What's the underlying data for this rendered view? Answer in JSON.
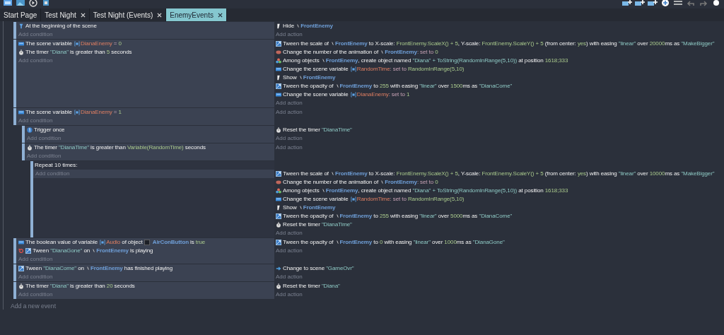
{
  "tabs": [
    {
      "label": "Start Page",
      "closable": false,
      "selected": false
    },
    {
      "label": "Test Night",
      "closable": true,
      "selected": false
    },
    {
      "label": "Test Night (Events)",
      "closable": true,
      "selected": false
    },
    {
      "label": "EnemyEvents",
      "closable": true,
      "selected": true
    }
  ],
  "events": [
    {
      "kind": "standard",
      "add_condition": "Add condition",
      "add_action": "Add action",
      "conditions": [
        {
          "kind": "scene-start",
          "inverted": false,
          "parts": [
            {
              "text": "At the beginning of the scene",
              "kind": "text"
            }
          ]
        }
      ],
      "actions": [
        {
          "kind": "visibility",
          "parts": [
            {
              "text": "Hide ",
              "kind": "text"
            },
            {
              "text": "FrontEnemy",
              "kind": "object"
            }
          ]
        }
      ]
    },
    {
      "kind": "standard",
      "add_condition": "Add condition",
      "add_action": "Add action",
      "conditions": [
        {
          "kind": "variable",
          "inverted": false,
          "parts": [
            {
              "text": "The scene variable ",
              "kind": "text"
            },
            {
              "text": "DianaEnemy",
              "kind": "variable"
            },
            {
              "text": " = ",
              "kind": "op"
            },
            {
              "text": "0",
              "kind": "number"
            }
          ]
        },
        {
          "kind": "timer",
          "inverted": false,
          "parts": [
            {
              "text": "The timer ",
              "kind": "text"
            },
            {
              "text": "\"Diana\"",
              "kind": "string"
            },
            {
              "text": " is greater than ",
              "kind": "text"
            },
            {
              "text": "5",
              "kind": "number"
            },
            {
              "text": " seconds",
              "kind": "text"
            }
          ]
        }
      ],
      "actions": [
        {
          "kind": "tween",
          "parts": [
            {
              "text": "Tween the scale of ",
              "kind": "text"
            },
            {
              "text": "FrontEnemy",
              "kind": "object"
            },
            {
              "text": " to X-scale: ",
              "kind": "text"
            },
            {
              "text": "FrontEnemy.ScaleX() + 5",
              "kind": "expr"
            },
            {
              "text": ", Y-scale: ",
              "kind": "text"
            },
            {
              "text": "FrontEnemy.ScaleY() + 5",
              "kind": "expr"
            },
            {
              "text": " (from center: ",
              "kind": "text"
            },
            {
              "text": "yes",
              "kind": "expr"
            },
            {
              "text": ") with easing ",
              "kind": "text"
            },
            {
              "text": "\"linear\"",
              "kind": "string"
            },
            {
              "text": " over ",
              "kind": "text"
            },
            {
              "text": "20000",
              "kind": "number"
            },
            {
              "text": "ms as ",
              "kind": "text"
            },
            {
              "text": "\"MakeBigger\"",
              "kind": "string"
            }
          ]
        },
        {
          "kind": "animation",
          "parts": [
            {
              "text": "Change the number of the animation of ",
              "kind": "text"
            },
            {
              "text": "FrontEnemy",
              "kind": "object"
            },
            {
              "text": ": set to ",
              "kind": "op"
            },
            {
              "text": "0",
              "kind": "number"
            }
          ]
        },
        {
          "kind": "create",
          "parts": [
            {
              "text": "Among objects ",
              "kind": "text"
            },
            {
              "text": "FrontEnemy",
              "kind": "object"
            },
            {
              "text": ", create object named ",
              "kind": "text"
            },
            {
              "text": "\"Diana\" + ToString(RandomInRange(5,10))",
              "kind": "string"
            },
            {
              "text": " at position ",
              "kind": "text"
            },
            {
              "text": "1618;333",
              "kind": "number"
            }
          ]
        },
        {
          "kind": "variable",
          "parts": [
            {
              "text": "Change the scene variable ",
              "kind": "text"
            },
            {
              "text": "RandomTime",
              "kind": "variable"
            },
            {
              "text": ": set to ",
              "kind": "op"
            },
            {
              "text": "RandomInRange(5,10)",
              "kind": "expr"
            }
          ]
        },
        {
          "kind": "visibility",
          "parts": [
            {
              "text": "Show ",
              "kind": "text"
            },
            {
              "text": "FrontEnemy",
              "kind": "object"
            }
          ]
        },
        {
          "kind": "tween",
          "parts": [
            {
              "text": "Tween the opacity of ",
              "kind": "text"
            },
            {
              "text": "FrontEnemy",
              "kind": "object"
            },
            {
              "text": " to ",
              "kind": "text"
            },
            {
              "text": "255",
              "kind": "number"
            },
            {
              "text": " with easing ",
              "kind": "text"
            },
            {
              "text": "\"linear\"",
              "kind": "string"
            },
            {
              "text": " over ",
              "kind": "text"
            },
            {
              "text": "1500",
              "kind": "number"
            },
            {
              "text": "ms as ",
              "kind": "text"
            },
            {
              "text": "\"DianaCome\"",
              "kind": "string"
            }
          ]
        },
        {
          "kind": "variable",
          "parts": [
            {
              "text": "Change the scene variable ",
              "kind": "text"
            },
            {
              "text": "DianaEnemy",
              "kind": "variable"
            },
            {
              "text": ": set to ",
              "kind": "op"
            },
            {
              "text": "1",
              "kind": "number"
            }
          ]
        }
      ]
    },
    {
      "kind": "standard",
      "add_condition": "Add condition",
      "add_action": "Add action",
      "conditions": [
        {
          "kind": "variable",
          "inverted": false,
          "parts": [
            {
              "text": "The scene variable ",
              "kind": "text"
            },
            {
              "text": "DianaEnemy",
              "kind": "variable"
            },
            {
              "text": " = ",
              "kind": "op"
            },
            {
              "text": "1",
              "kind": "number"
            }
          ]
        }
      ],
      "children": [
        {
          "kind": "standard",
          "add_condition": "Add condition",
          "add_action": "Add action",
          "conditions": [
            {
              "kind": "trigger",
              "inverted": false,
              "parts": [
                {
                  "text": "Trigger once",
                  "kind": "text"
                }
              ]
            }
          ],
          "actions": [
            {
              "kind": "timer",
              "parts": [
                {
                  "text": "Reset the timer ",
                  "kind": "text"
                },
                {
                  "text": "\"DianaTime\"",
                  "kind": "string"
                }
              ]
            }
          ]
        },
        {
          "kind": "standard",
          "add_condition": "Add condition",
          "add_action": "Add action",
          "conditions": [
            {
              "kind": "timer",
              "inverted": false,
              "parts": [
                {
                  "text": "The timer ",
                  "kind": "text"
                },
                {
                  "text": "\"DianaTime\"",
                  "kind": "string"
                },
                {
                  "text": " is greater than ",
                  "kind": "text"
                },
                {
                  "text": "Variable(RandomTime)",
                  "kind": "expr"
                },
                {
                  "text": " seconds",
                  "kind": "text"
                }
              ]
            }
          ],
          "children": [
            {
              "kind": "repeat",
              "header": "Repeat 10 times:",
              "add_condition": "Add condition",
              "add_action": "Add action",
              "actions": [
                {
                  "kind": "tween",
                  "parts": [
                    {
                      "text": "Tween the scale of ",
                      "kind": "text"
                    },
                    {
                      "text": "FrontEnemy",
                      "kind": "object"
                    },
                    {
                      "text": " to X-scale: ",
                      "kind": "text"
                    },
                    {
                      "text": "FrontEnemy.ScaleX() + 5",
                      "kind": "expr"
                    },
                    {
                      "text": ", Y-scale: ",
                      "kind": "text"
                    },
                    {
                      "text": "FrontEnemy.ScaleY() + 5",
                      "kind": "expr"
                    },
                    {
                      "text": " (from center: ",
                      "kind": "text"
                    },
                    {
                      "text": "yes",
                      "kind": "expr"
                    },
                    {
                      "text": ") with easing ",
                      "kind": "text"
                    },
                    {
                      "text": "\"linear\"",
                      "kind": "string"
                    },
                    {
                      "text": " over ",
                      "kind": "text"
                    },
                    {
                      "text": "10000",
                      "kind": "number"
                    },
                    {
                      "text": "ms as ",
                      "kind": "text"
                    },
                    {
                      "text": "\"MakeBigger\"",
                      "kind": "string"
                    }
                  ]
                },
                {
                  "kind": "animation",
                  "parts": [
                    {
                      "text": "Change the number of the animation of ",
                      "kind": "text"
                    },
                    {
                      "text": "FrontEnemy",
                      "kind": "object"
                    },
                    {
                      "text": ": set to ",
                      "kind": "op"
                    },
                    {
                      "text": "0",
                      "kind": "number"
                    }
                  ]
                },
                {
                  "kind": "create",
                  "parts": [
                    {
                      "text": "Among objects ",
                      "kind": "text"
                    },
                    {
                      "text": "FrontEnemy",
                      "kind": "object"
                    },
                    {
                      "text": ", create object named ",
                      "kind": "text"
                    },
                    {
                      "text": "\"Diana\" + ToString(RandomInRange(5,10))",
                      "kind": "string"
                    },
                    {
                      "text": " at position ",
                      "kind": "text"
                    },
                    {
                      "text": "1618;333",
                      "kind": "number"
                    }
                  ]
                },
                {
                  "kind": "variable",
                  "parts": [
                    {
                      "text": "Change the scene variable ",
                      "kind": "text"
                    },
                    {
                      "text": "RandomTime",
                      "kind": "variable"
                    },
                    {
                      "text": ": set to ",
                      "kind": "op"
                    },
                    {
                      "text": "RandomInRange(5,10)",
                      "kind": "expr"
                    }
                  ]
                },
                {
                  "kind": "visibility",
                  "parts": [
                    {
                      "text": "Show ",
                      "kind": "text"
                    },
                    {
                      "text": "FrontEnemy",
                      "kind": "object"
                    }
                  ]
                },
                {
                  "kind": "tween",
                  "parts": [
                    {
                      "text": "Tween the opacity of ",
                      "kind": "text"
                    },
                    {
                      "text": "FrontEnemy",
                      "kind": "object"
                    },
                    {
                      "text": " to ",
                      "kind": "text"
                    },
                    {
                      "text": "255",
                      "kind": "number"
                    },
                    {
                      "text": " with easing ",
                      "kind": "text"
                    },
                    {
                      "text": "\"linear\"",
                      "kind": "string"
                    },
                    {
                      "text": " over ",
                      "kind": "text"
                    },
                    {
                      "text": "5000",
                      "kind": "number"
                    },
                    {
                      "text": "ms as ",
                      "kind": "text"
                    },
                    {
                      "text": "\"DianaCome\"",
                      "kind": "string"
                    }
                  ]
                },
                {
                  "kind": "timer",
                  "parts": [
                    {
                      "text": "Reset the timer ",
                      "kind": "text"
                    },
                    {
                      "text": "\"DianaTime\"",
                      "kind": "string"
                    }
                  ]
                }
              ]
            }
          ]
        }
      ]
    },
    {
      "kind": "standard",
      "add_condition": "Add condition",
      "add_action": "Add action",
      "conditions": [
        {
          "kind": "boolean",
          "inverted": false,
          "parts": [
            {
              "text": "The boolean value of variable ",
              "kind": "text"
            },
            {
              "text": "Audio",
              "kind": "variable"
            },
            {
              "text": " of object ",
              "kind": "text"
            },
            {
              "text": "AirConButton",
              "kind": "button-object"
            },
            {
              "text": " is ",
              "kind": "text"
            },
            {
              "text": "true",
              "kind": "expr"
            }
          ]
        },
        {
          "kind": "tween",
          "inverted": true,
          "parts": [
            {
              "text": "Tween ",
              "kind": "text"
            },
            {
              "text": "\"DianaGone\"",
              "kind": "string"
            },
            {
              "text": " on ",
              "kind": "text"
            },
            {
              "text": "FrontEnemy",
              "kind": "object"
            },
            {
              "text": " is playing",
              "kind": "text"
            }
          ]
        }
      ],
      "actions": [
        {
          "kind": "tween",
          "parts": [
            {
              "text": "Tween the opacity of ",
              "kind": "text"
            },
            {
              "text": "FrontEnemy",
              "kind": "object"
            },
            {
              "text": " to ",
              "kind": "text"
            },
            {
              "text": "0",
              "kind": "number"
            },
            {
              "text": " with easing ",
              "kind": "text"
            },
            {
              "text": "\"linear\"",
              "kind": "string"
            },
            {
              "text": " over ",
              "kind": "text"
            },
            {
              "text": "1000",
              "kind": "number"
            },
            {
              "text": "ms as ",
              "kind": "text"
            },
            {
              "text": "\"DianaGone\"",
              "kind": "string"
            }
          ]
        }
      ]
    },
    {
      "kind": "standard",
      "add_condition": "Add condition",
      "add_action": "Add action",
      "conditions": [
        {
          "kind": "tween",
          "inverted": false,
          "parts": [
            {
              "text": "Tween ",
              "kind": "text"
            },
            {
              "text": "\"DianaCome\"",
              "kind": "string"
            },
            {
              "text": " on ",
              "kind": "text"
            },
            {
              "text": "FrontEnemy",
              "kind": "object"
            },
            {
              "text": " has finished playing",
              "kind": "text"
            }
          ]
        }
      ],
      "actions": [
        {
          "kind": "scene-change",
          "parts": [
            {
              "text": "Change to scene ",
              "kind": "text"
            },
            {
              "text": "\"GameOvr\"",
              "kind": "string"
            }
          ]
        }
      ]
    },
    {
      "kind": "standard",
      "add_condition": "Add condition",
      "add_action": "Add action",
      "conditions": [
        {
          "kind": "timer",
          "inverted": false,
          "parts": [
            {
              "text": "The timer ",
              "kind": "text"
            },
            {
              "text": "\"Diana\"",
              "kind": "string"
            },
            {
              "text": " is greater than ",
              "kind": "text"
            },
            {
              "text": "20",
              "kind": "number"
            },
            {
              "text": " seconds",
              "kind": "text"
            }
          ]
        }
      ],
      "actions": [
        {
          "kind": "timer",
          "parts": [
            {
              "text": "Reset the timer ",
              "kind": "text"
            },
            {
              "text": "\"Diana\"",
              "kind": "string"
            }
          ]
        }
      ]
    }
  ],
  "add_event": "Add a new event"
}
